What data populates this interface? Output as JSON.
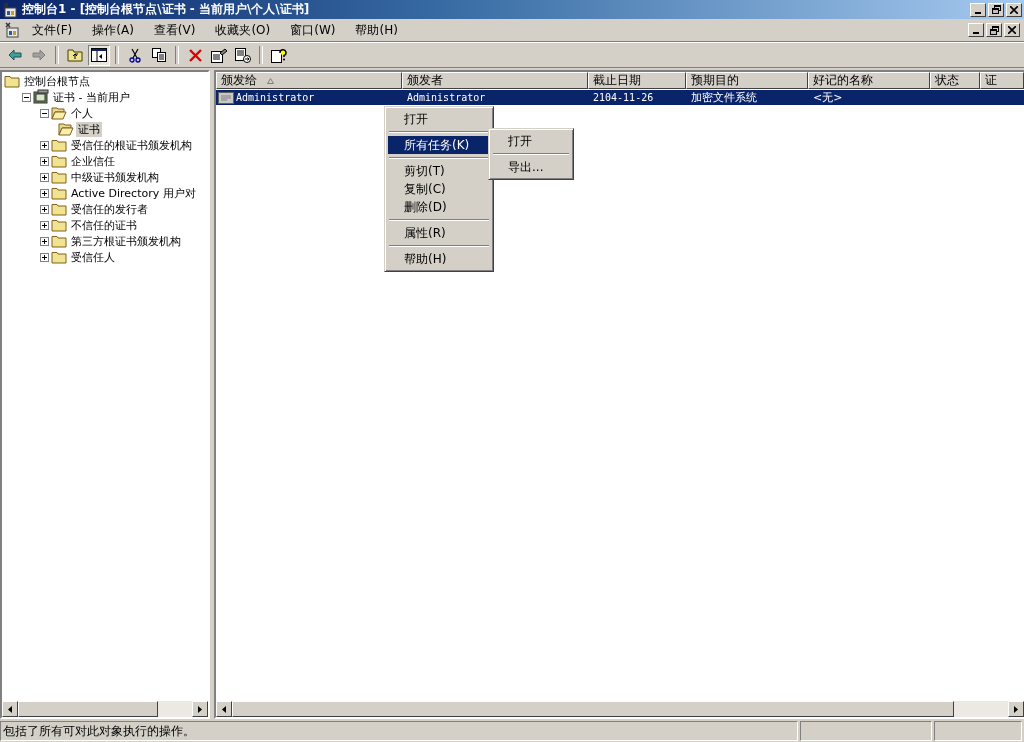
{
  "window": {
    "title": "控制台1 - [控制台根节点\\证书 - 当前用户\\个人\\证书]"
  },
  "menu_bar": [
    {
      "label": "文件(F)"
    },
    {
      "label": "操作(A)"
    },
    {
      "label": "查看(V)"
    },
    {
      "label": "收藏夹(O)"
    },
    {
      "label": "窗口(W)"
    },
    {
      "label": "帮助(H)"
    }
  ],
  "tree": {
    "label": "控制台根节点",
    "kind": "folder",
    "selected": false,
    "children": [
      {
        "label": "证书 - 当前用户",
        "kind": "store",
        "expanded": true,
        "selected": false,
        "children": [
          {
            "label": "个人",
            "kind": "open-folder",
            "expanded": true,
            "selected": false,
            "children": [
              {
                "label": "证书",
                "kind": "open-folder",
                "selected": true
              }
            ]
          },
          {
            "label": "受信任的根证书颁发机构",
            "kind": "folder",
            "expanded": false,
            "selected": false
          },
          {
            "label": "企业信任",
            "kind": "folder",
            "expanded": false,
            "selected": false
          },
          {
            "label": "中级证书颁发机构",
            "kind": "folder",
            "expanded": false,
            "selected": false
          },
          {
            "label": "Active Directory 用户对",
            "kind": "folder",
            "expanded": false,
            "selected": false
          },
          {
            "label": "受信任的发行者",
            "kind": "folder",
            "expanded": false,
            "selected": false
          },
          {
            "label": "不信任的证书",
            "kind": "folder",
            "expanded": false,
            "selected": false
          },
          {
            "label": "第三方根证书颁发机构",
            "kind": "folder",
            "expanded": false,
            "selected": false
          },
          {
            "label": "受信任人",
            "kind": "folder",
            "expanded": false,
            "selected": false
          }
        ]
      }
    ]
  },
  "table": {
    "columns": [
      {
        "label": "颁发给",
        "sorted": true
      },
      {
        "label": "颁发者",
        "sorted": false
      },
      {
        "label": "截止日期",
        "sorted": false
      },
      {
        "label": "预期目的",
        "sorted": false
      },
      {
        "label": "好记的名称",
        "sorted": false
      },
      {
        "label": "状态",
        "sorted": false
      },
      {
        "label": "证",
        "sorted": false
      }
    ],
    "rows": [
      {
        "cells": [
          "Administrator",
          "Administrator",
          "2104-11-26",
          "加密文件系统",
          "<无>"
        ],
        "selected": true
      }
    ]
  },
  "context_menu": [
    {
      "kind": "item",
      "label": "打开",
      "selected": false,
      "submenu": false
    },
    {
      "kind": "separator"
    },
    {
      "kind": "item",
      "label": "所有任务(K)",
      "selected": true,
      "submenu": true
    },
    {
      "kind": "separator"
    },
    {
      "kind": "item",
      "label": "剪切(T)",
      "selected": false,
      "submenu": false
    },
    {
      "kind": "item",
      "label": "复制(C)",
      "selected": false,
      "submenu": false
    },
    {
      "kind": "item",
      "label": "删除(D)",
      "selected": false,
      "submenu": false
    },
    {
      "kind": "separator"
    },
    {
      "kind": "item",
      "label": "属性(R)",
      "selected": false,
      "submenu": false
    },
    {
      "kind": "separator"
    },
    {
      "kind": "item",
      "label": "帮助(H)",
      "selected": false,
      "submenu": false
    }
  ],
  "submenu": [
    {
      "kind": "item",
      "label": "打开",
      "selected": false,
      "submenu": false
    },
    {
      "kind": "separator"
    },
    {
      "kind": "item",
      "label": "导出...",
      "selected": false,
      "submenu": false
    }
  ],
  "status_bar": {
    "text": "包括了所有可对此对象执行的操作。"
  }
}
